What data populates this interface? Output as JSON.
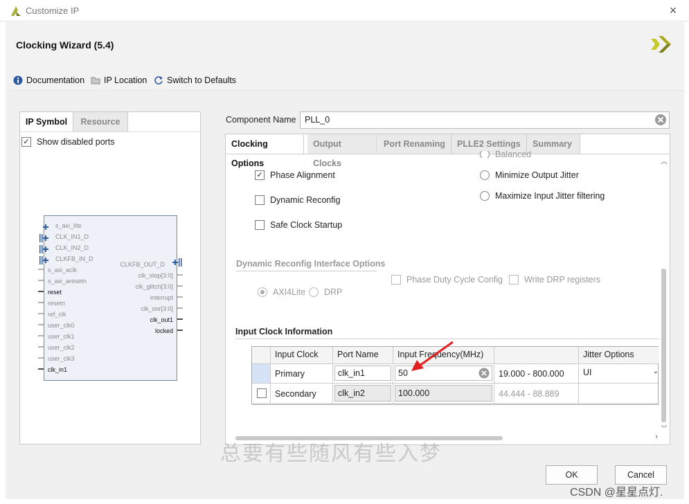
{
  "window": {
    "title": "Customize IP",
    "close_glyph": "×"
  },
  "header": {
    "wizard_title": "Clocking Wizard (5.4)"
  },
  "toolbar": {
    "documentation": "Documentation",
    "ip_location": "IP Location",
    "switch_defaults": "Switch to Defaults"
  },
  "left": {
    "tabs": [
      "IP Symbol",
      "Resource"
    ],
    "show_disabled": "Show disabled ports",
    "pins_left": [
      "s_axi_lite",
      "CLK_IN1_D",
      "CLK_IN2_D",
      "CLKFB_IN_D",
      "s_axi_aclk",
      "s_axi_aresetn",
      "reset",
      "resetn",
      "ref_clk",
      "user_clk0",
      "user_clk1",
      "user_clk2",
      "user_clk3",
      "clk_in1"
    ],
    "pins_right": [
      "CLKFB_OUT_D",
      "clk_stop[3:0]",
      "clk_glitch[3:0]",
      "interrupt",
      "clk_oor[3:0]",
      "clk_out1",
      "locked"
    ]
  },
  "component": {
    "label": "Component Name",
    "value": "PLL_0"
  },
  "tabs": [
    "Clocking Options",
    "Output Clocks",
    "Port Renaming",
    "PLLE2 Settings",
    "Summary"
  ],
  "options": {
    "balanced": "Balanced",
    "phase_alignment": "Phase Alignment",
    "dynamic_reconfig": "Dynamic Reconfig",
    "safe_clock": "Safe Clock Startup",
    "min_output_jitter": "Minimize Output Jitter",
    "max_input_jitter": "Maximize Input Jitter filtering"
  },
  "dyn_reconfig": {
    "title": "Dynamic Reconfig Interface Options",
    "axi4lite": "AXI4Lite",
    "drp": "DRP",
    "phase_duty": "Phase Duty Cycle Config",
    "write_drp": "Write DRP registers"
  },
  "input_clock": {
    "title": "Input Clock Information",
    "headers": [
      "Input Clock",
      "Port Name",
      "Input Frequency(MHz)",
      "",
      "Jitter Options"
    ],
    "rows": [
      {
        "clock": "Primary",
        "port": "clk_in1",
        "freq": "50",
        "range": "19.000 - 800.000",
        "jitter": "UI"
      },
      {
        "clock": "Secondary",
        "port": "clk_in2",
        "freq": "100.000",
        "range": "44.444 - 88.889",
        "jitter": ""
      }
    ]
  },
  "buttons": {
    "ok": "OK",
    "cancel": "Cancel"
  },
  "watermark": {
    "text": "总要有些随风有些入梦",
    "csdn": "CSDN @星星点灯."
  },
  "colors": {
    "accent": "#e8eef8",
    "arrow": "#e02020"
  }
}
